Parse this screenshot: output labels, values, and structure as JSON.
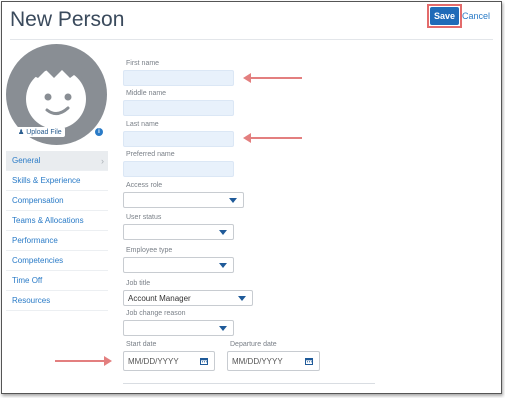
{
  "page": {
    "title": "New Person"
  },
  "toolbar": {
    "save_label": "Save",
    "cancel_label": "Cancel"
  },
  "avatar": {
    "upload_label": "Upload File"
  },
  "sidebar": {
    "items": [
      {
        "label": "General",
        "active": true
      },
      {
        "label": "Skills & Experience"
      },
      {
        "label": "Compensation"
      },
      {
        "label": "Teams & Allocations"
      },
      {
        "label": "Performance"
      },
      {
        "label": "Competencies"
      },
      {
        "label": "Time Off"
      },
      {
        "label": "Resources"
      }
    ]
  },
  "form": {
    "first_name": {
      "label": "First name",
      "value": ""
    },
    "middle_name": {
      "label": "Middle name",
      "value": ""
    },
    "last_name": {
      "label": "Last name",
      "value": ""
    },
    "preferred_name": {
      "label": "Preferred name",
      "value": ""
    },
    "access_role": {
      "label": "Access role",
      "value": ""
    },
    "user_status": {
      "label": "User status",
      "value": ""
    },
    "employee_type": {
      "label": "Employee type",
      "value": ""
    },
    "job_title": {
      "label": "Job title",
      "value": "Account Manager"
    },
    "job_change_reason": {
      "label": "Job change reason",
      "value": ""
    },
    "start_date": {
      "label": "Start date",
      "placeholder": "MM/DD/YYYY"
    },
    "departure_date": {
      "label": "Departure date",
      "placeholder": "MM/DD/YYYY"
    }
  },
  "colors": {
    "accent": "#1f6bb8",
    "highlight": "#e36b6b",
    "field_bg": "#e8f1fb"
  },
  "icons": [
    "user-icon",
    "info-icon",
    "chevron-right-icon",
    "caret-down-icon",
    "calendar-icon"
  ]
}
